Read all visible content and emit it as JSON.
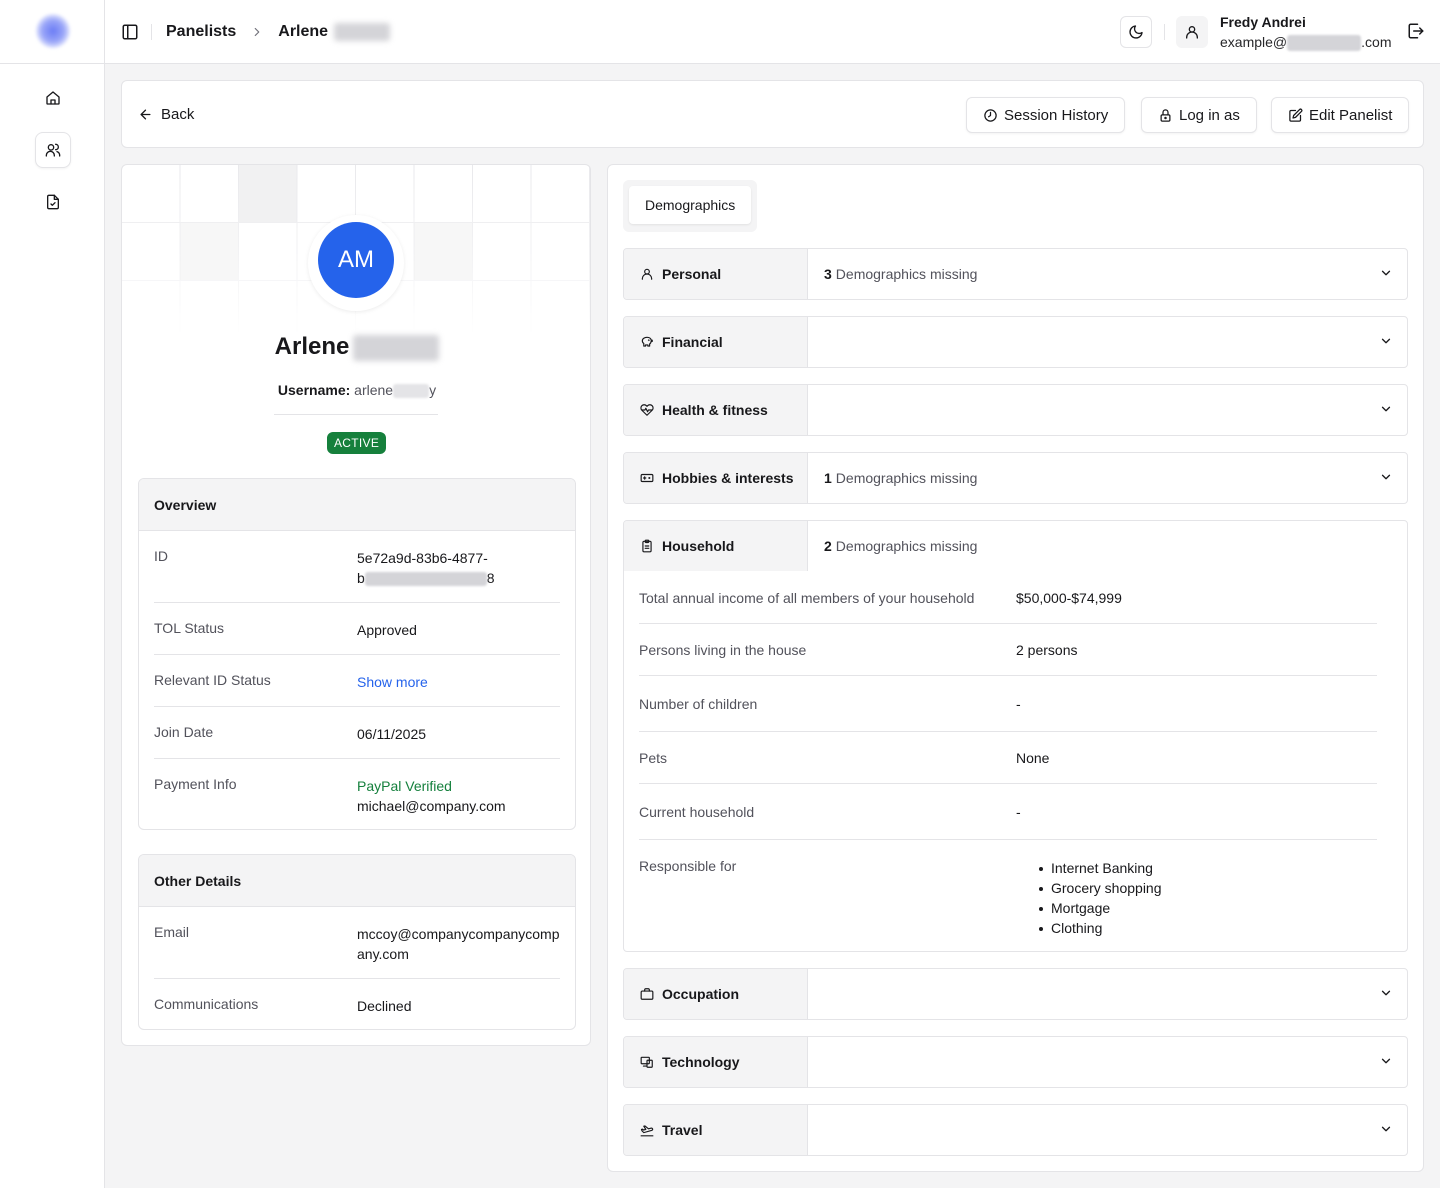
{
  "header": {
    "breadcrumb": [
      "Panelists",
      "Arlene"
    ],
    "user_name": "Fredy Andrei",
    "user_email_prefix": "example@",
    "user_email_suffix": ".com"
  },
  "toolbar": {
    "back_label": "Back",
    "session_history_label": "Session History",
    "login_as_label": "Log in as",
    "edit_label": "Edit Panelist"
  },
  "profile": {
    "initials": "AM",
    "first_name": "Arlene",
    "username_label": "Username:",
    "username_value_start": "arlene",
    "username_value_end": "y",
    "status": "ACTIVE"
  },
  "overview": {
    "title": "Overview",
    "rows": [
      {
        "label": "ID",
        "value_line1": "5e72a9d-83b6-4877-",
        "value_line2_start": "b",
        "value_line2_end": "8"
      },
      {
        "label": "TOL Status",
        "value": "Approved"
      },
      {
        "label": "Relevant ID Status",
        "value": "Show more"
      },
      {
        "label": "Join Date",
        "value": "06/11/2025"
      },
      {
        "label": "Payment Info",
        "value": "PayPal Verified",
        "value2": "michael@company.com"
      }
    ]
  },
  "other_details": {
    "title": "Other Details",
    "rows": [
      {
        "label": "Email",
        "value": "mccoy@companycompanycompany.com"
      },
      {
        "label": "Communications",
        "value": "Declined"
      }
    ]
  },
  "demographics": {
    "tab": "Demographics",
    "missing_suffix": "Demographics missing",
    "categories": [
      {
        "label": "Personal",
        "icon": "user-icon",
        "missing": "3"
      },
      {
        "label": "Financial",
        "icon": "piggy-bank-icon",
        "missing": ""
      },
      {
        "label": "Health & fitness",
        "icon": "heart-pulse-icon",
        "missing": ""
      },
      {
        "label": "Hobbies & interests",
        "icon": "ticket-icon",
        "missing": "1"
      },
      {
        "label": "Household",
        "icon": "clipboard-icon",
        "missing": "2"
      },
      {
        "label": "Occupation",
        "icon": "briefcase-icon",
        "missing": ""
      },
      {
        "label": "Technology",
        "icon": "devices-icon",
        "missing": ""
      },
      {
        "label": "Travel",
        "icon": "plane-icon",
        "missing": ""
      }
    ],
    "household": [
      {
        "label": "Total annual income of all members of your household",
        "value": "$50,000-$74,999"
      },
      {
        "label": "Persons living in the house",
        "value": "2 persons"
      },
      {
        "label": "Number of children",
        "value": "-"
      },
      {
        "label": "Pets",
        "value": "None"
      },
      {
        "label": "Current household",
        "value": "-"
      },
      {
        "label": "Responsible for",
        "items": [
          "Internet Banking",
          "Grocery shopping",
          "Mortgage",
          "Clothing"
        ]
      }
    ]
  },
  "colors": {
    "accent": "#2563eb",
    "active_badge": "#16803c",
    "paypal_green": "#15803d",
    "link_blue": "#2563eb"
  }
}
